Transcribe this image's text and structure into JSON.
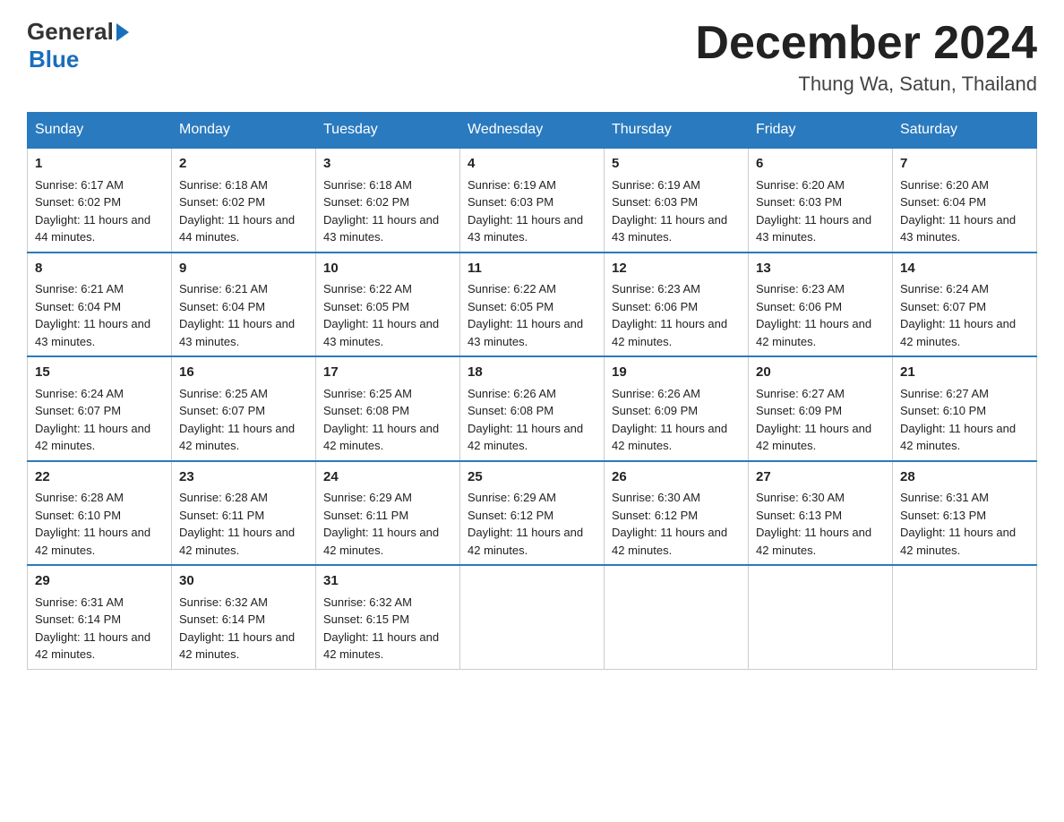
{
  "header": {
    "logo_general": "General",
    "logo_blue": "Blue",
    "month_title": "December 2024",
    "location": "Thung Wa, Satun, Thailand"
  },
  "weekdays": [
    "Sunday",
    "Monday",
    "Tuesday",
    "Wednesday",
    "Thursday",
    "Friday",
    "Saturday"
  ],
  "weeks": [
    [
      {
        "day": "1",
        "sunrise": "6:17 AM",
        "sunset": "6:02 PM",
        "daylight": "11 hours and 44 minutes."
      },
      {
        "day": "2",
        "sunrise": "6:18 AM",
        "sunset": "6:02 PM",
        "daylight": "11 hours and 44 minutes."
      },
      {
        "day": "3",
        "sunrise": "6:18 AM",
        "sunset": "6:02 PM",
        "daylight": "11 hours and 43 minutes."
      },
      {
        "day": "4",
        "sunrise": "6:19 AM",
        "sunset": "6:03 PM",
        "daylight": "11 hours and 43 minutes."
      },
      {
        "day": "5",
        "sunrise": "6:19 AM",
        "sunset": "6:03 PM",
        "daylight": "11 hours and 43 minutes."
      },
      {
        "day": "6",
        "sunrise": "6:20 AM",
        "sunset": "6:03 PM",
        "daylight": "11 hours and 43 minutes."
      },
      {
        "day": "7",
        "sunrise": "6:20 AM",
        "sunset": "6:04 PM",
        "daylight": "11 hours and 43 minutes."
      }
    ],
    [
      {
        "day": "8",
        "sunrise": "6:21 AM",
        "sunset": "6:04 PM",
        "daylight": "11 hours and 43 minutes."
      },
      {
        "day": "9",
        "sunrise": "6:21 AM",
        "sunset": "6:04 PM",
        "daylight": "11 hours and 43 minutes."
      },
      {
        "day": "10",
        "sunrise": "6:22 AM",
        "sunset": "6:05 PM",
        "daylight": "11 hours and 43 minutes."
      },
      {
        "day": "11",
        "sunrise": "6:22 AM",
        "sunset": "6:05 PM",
        "daylight": "11 hours and 43 minutes."
      },
      {
        "day": "12",
        "sunrise": "6:23 AM",
        "sunset": "6:06 PM",
        "daylight": "11 hours and 42 minutes."
      },
      {
        "day": "13",
        "sunrise": "6:23 AM",
        "sunset": "6:06 PM",
        "daylight": "11 hours and 42 minutes."
      },
      {
        "day": "14",
        "sunrise": "6:24 AM",
        "sunset": "6:07 PM",
        "daylight": "11 hours and 42 minutes."
      }
    ],
    [
      {
        "day": "15",
        "sunrise": "6:24 AM",
        "sunset": "6:07 PM",
        "daylight": "11 hours and 42 minutes."
      },
      {
        "day": "16",
        "sunrise": "6:25 AM",
        "sunset": "6:07 PM",
        "daylight": "11 hours and 42 minutes."
      },
      {
        "day": "17",
        "sunrise": "6:25 AM",
        "sunset": "6:08 PM",
        "daylight": "11 hours and 42 minutes."
      },
      {
        "day": "18",
        "sunrise": "6:26 AM",
        "sunset": "6:08 PM",
        "daylight": "11 hours and 42 minutes."
      },
      {
        "day": "19",
        "sunrise": "6:26 AM",
        "sunset": "6:09 PM",
        "daylight": "11 hours and 42 minutes."
      },
      {
        "day": "20",
        "sunrise": "6:27 AM",
        "sunset": "6:09 PM",
        "daylight": "11 hours and 42 minutes."
      },
      {
        "day": "21",
        "sunrise": "6:27 AM",
        "sunset": "6:10 PM",
        "daylight": "11 hours and 42 minutes."
      }
    ],
    [
      {
        "day": "22",
        "sunrise": "6:28 AM",
        "sunset": "6:10 PM",
        "daylight": "11 hours and 42 minutes."
      },
      {
        "day": "23",
        "sunrise": "6:28 AM",
        "sunset": "6:11 PM",
        "daylight": "11 hours and 42 minutes."
      },
      {
        "day": "24",
        "sunrise": "6:29 AM",
        "sunset": "6:11 PM",
        "daylight": "11 hours and 42 minutes."
      },
      {
        "day": "25",
        "sunrise": "6:29 AM",
        "sunset": "6:12 PM",
        "daylight": "11 hours and 42 minutes."
      },
      {
        "day": "26",
        "sunrise": "6:30 AM",
        "sunset": "6:12 PM",
        "daylight": "11 hours and 42 minutes."
      },
      {
        "day": "27",
        "sunrise": "6:30 AM",
        "sunset": "6:13 PM",
        "daylight": "11 hours and 42 minutes."
      },
      {
        "day": "28",
        "sunrise": "6:31 AM",
        "sunset": "6:13 PM",
        "daylight": "11 hours and 42 minutes."
      }
    ],
    [
      {
        "day": "29",
        "sunrise": "6:31 AM",
        "sunset": "6:14 PM",
        "daylight": "11 hours and 42 minutes."
      },
      {
        "day": "30",
        "sunrise": "6:32 AM",
        "sunset": "6:14 PM",
        "daylight": "11 hours and 42 minutes."
      },
      {
        "day": "31",
        "sunrise": "6:32 AM",
        "sunset": "6:15 PM",
        "daylight": "11 hours and 42 minutes."
      },
      null,
      null,
      null,
      null
    ]
  ]
}
